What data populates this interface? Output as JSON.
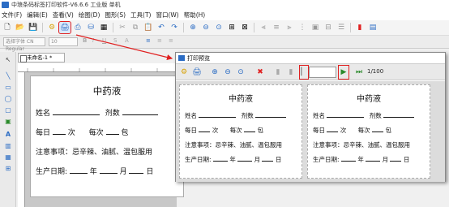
{
  "window": {
    "title": "中琅条码标签打印软件-V6.6.6 工业版 单机"
  },
  "menu": [
    "文件(F)",
    "编辑(E)",
    "查看(V)",
    "绘图(D)",
    "图形(S)",
    "工具(T)",
    "窗口(W)",
    "帮助(H)"
  ],
  "toolbar": {
    "font_placeholder": "选择字体 CN Regular",
    "font_size": "10"
  },
  "document": {
    "tab_label": "未命名-1 *"
  },
  "label": {
    "title": "中药液",
    "name_label": "姓名",
    "dose_label": "剂数",
    "daily_label": "每日",
    "times_unit": "次",
    "each_label": "每次",
    "pack_unit": "包",
    "notice": "注意事项：忌辛辣、油腻、温包服用",
    "date_label": "生产日期:",
    "year": "年",
    "month": "月",
    "day": "日"
  },
  "preview": {
    "title": "打印预览",
    "page_count": "1/100",
    "labels_shown": 2
  },
  "colors": {
    "highlight": "#e02020",
    "accent": "#2b6cc4"
  }
}
